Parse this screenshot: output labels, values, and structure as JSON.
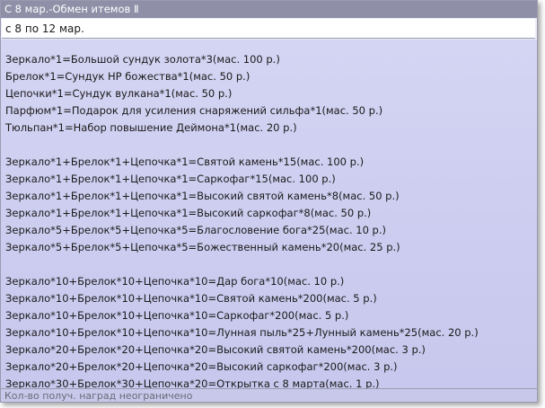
{
  "window": {
    "title": "С 8 мар.-Обмен итемов Ⅱ",
    "subtitle": "с 8 по 12 мар.",
    "footer": "Кол-во получ. наград неограничено"
  },
  "sections": [
    {
      "lines": [
        "Зеркало*1=Большой сундук золота*3(мас. 100 р.)",
        "Брелок*1=Сундук HP божества*1(мас. 50 р.)",
        "Цепочки*1=Сундук вулкана*1(мас. 50 р.)",
        "Парфюм*1=Подарок для усиления снаряжений сильфа*1(мас. 50 р.)",
        "Тюльпан*1=Набор повышение Деймона*1(мас. 20 р.)"
      ]
    },
    {
      "lines": [
        "Зеркало*1+Брелок*1+Цепочка*1=Святой камень*15(мас. 100 р.)",
        "Зеркало*1+Брелок*1+Цепочка*1=Саркофаг*15(мас. 100 р.)",
        "Зеркало*1+Брелок*1+Цепочка*1=Высокий святой камень*8(мас. 50 р.)",
        "Зеркало*1+Брелок*1+Цепочка*1=Высокий саркофаг*8(мас. 50 р.)",
        "Зеркало*5+Брелок*5+Цепочка*5=Благословение бога*25(мас. 10 р.)",
        "Зеркало*5+Брелок*5+Цепочка*5=Божественный камень*20(мас. 25 р.)"
      ]
    },
    {
      "lines": [
        "Зеркало*10+Брелок*10+Цепочка*10=Дар бога*10(мас. 10 р.)",
        "Зеркало*10+Брелок*10+Цепочка*10=Святой камень*200(мас. 5 р.)",
        "Зеркало*10+Брелок*10+Цепочка*10=Саркофаг*200(мас. 5 р.)",
        "Зеркало*10+Брелок*10+Цепочка*10=Лунная пыль*25+Лунный камень*25(мас. 20 р.)",
        "Зеркало*20+Брелок*20+Цепочка*20=Высокий святой камень*200(мас. 3 р.)",
        "Зеркало*20+Брелок*20+Цепочка*20=Высокий саркофаг*200(мас. 3 р.)",
        "Зеркало*30+Брелок*30+Цепочка*20=Открытка с 8 марта(мас. 1 р.)"
      ]
    }
  ]
}
